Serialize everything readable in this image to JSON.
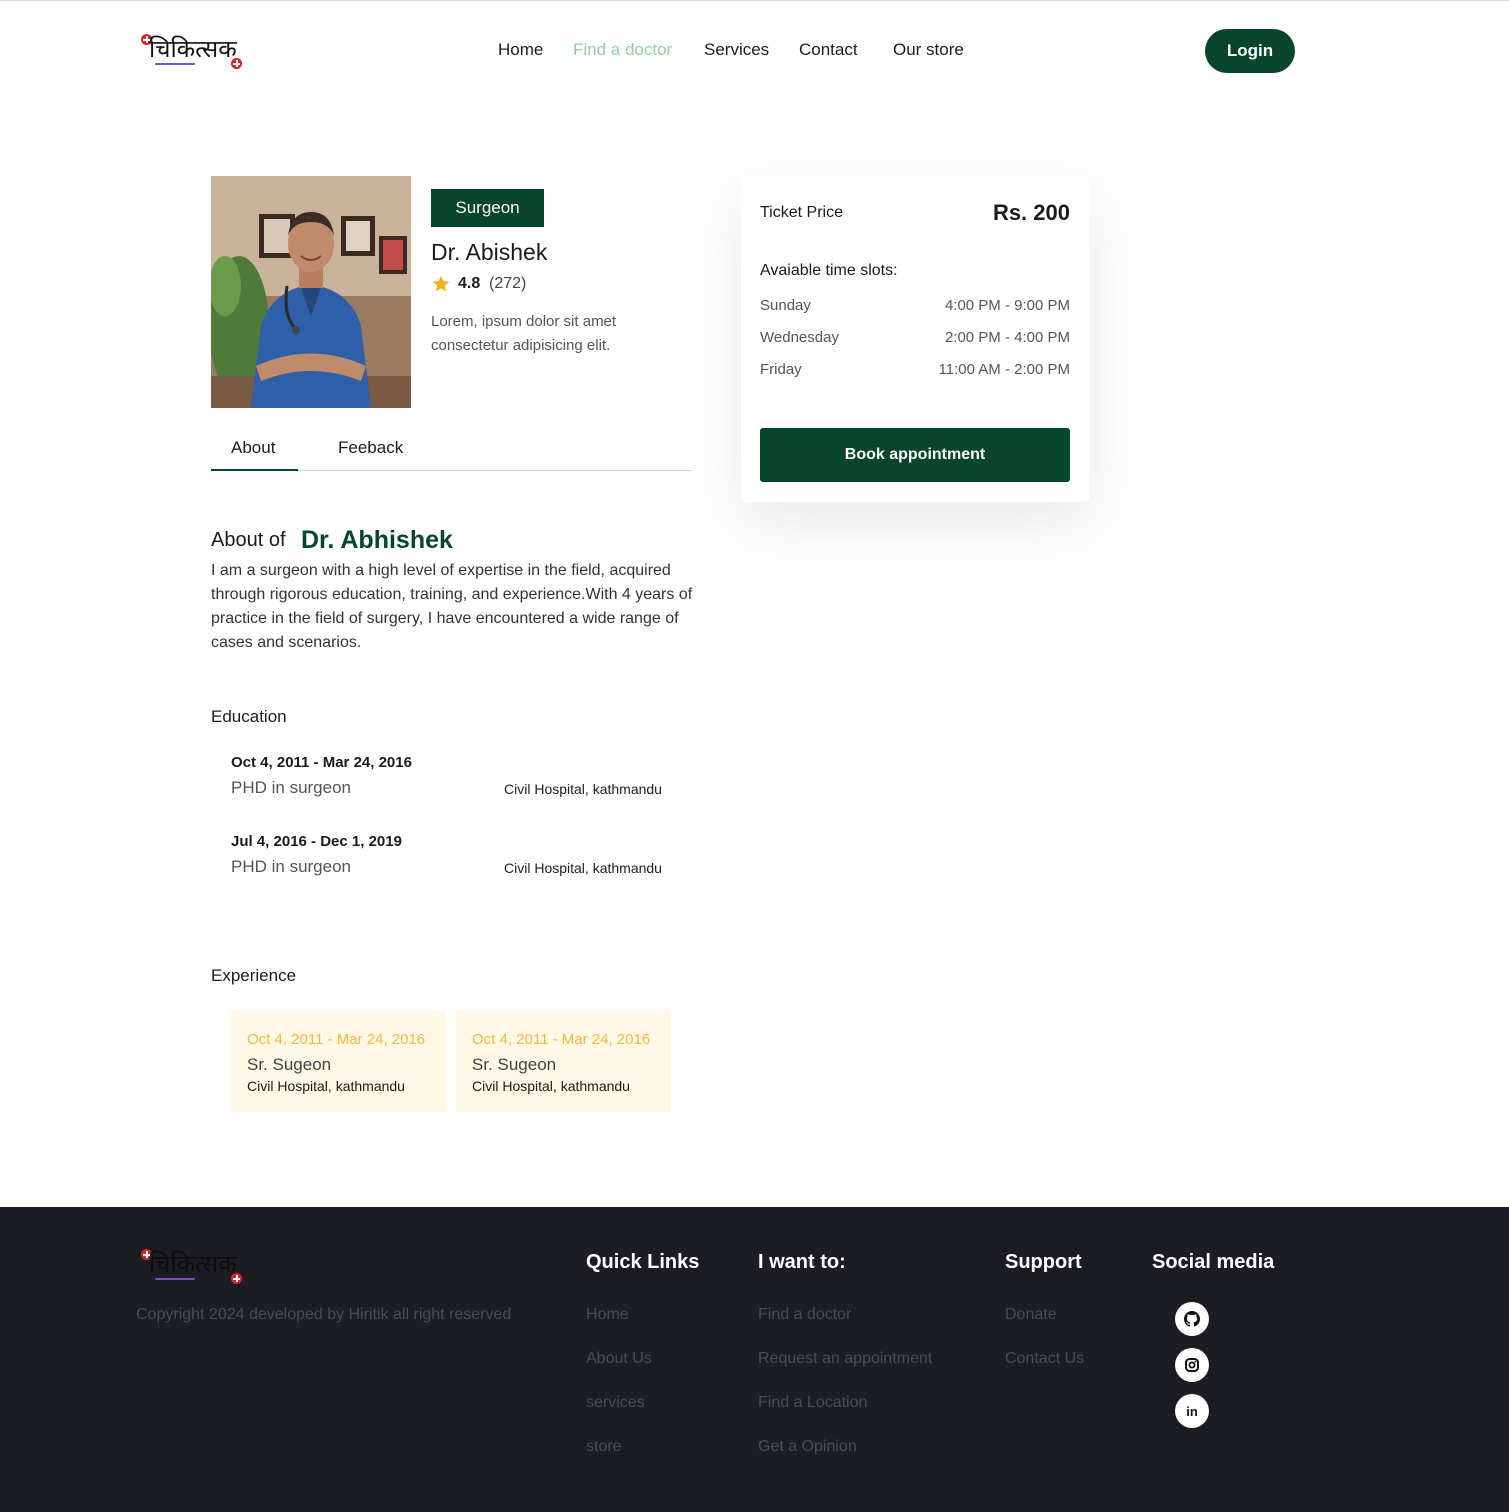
{
  "header": {
    "logo_text": "चिकित्सक",
    "nav": [
      "Home",
      "Find a doctor",
      "Services",
      "Contact",
      "Our store"
    ],
    "login_label": "Login"
  },
  "doctor": {
    "specialty": "Surgeon",
    "name": "Dr. Abishek",
    "rating": "4.8",
    "rating_count": "(272)",
    "short_desc": "Lorem, ipsum dolor sit amet consectetur adipisicing elit."
  },
  "tabs": [
    "About",
    "Feeback"
  ],
  "about": {
    "heading_prefix": "About of",
    "heading_name": "Dr. Abhishek",
    "text": "I am a surgeon with a high level of expertise in the field, acquired through rigorous education, training, and experience.With 4 years of practice in the field of surgery, I have encountered a wide range of cases and scenarios."
  },
  "education": {
    "heading": "Education",
    "items": [
      {
        "date": "Oct 4, 2011 - Mar 24, 2016",
        "degree": "PHD in surgeon",
        "place": "Civil Hospital, kathmandu"
      },
      {
        "date": "Jul 4, 2016 - Dec 1, 2019",
        "degree": "PHD in surgeon",
        "place": "Civil Hospital, kathmandu"
      }
    ]
  },
  "experience": {
    "heading": "Experience",
    "items": [
      {
        "date": "Oct 4, 2011 - Mar 24, 2016",
        "role": "Sr. Sugeon",
        "place": "Civil Hospital, kathmandu"
      },
      {
        "date": "Oct 4, 2011 - Mar 24, 2016",
        "role": "Sr. Sugeon",
        "place": "Civil Hospital, kathmandu"
      }
    ]
  },
  "ticket": {
    "label": "Ticket Price",
    "price": "Rs. 200",
    "slots_heading": "Avaiable time slots:",
    "slots": [
      {
        "day": "Sunday",
        "time": "4:00 PM - 9:00 PM"
      },
      {
        "day": "Wednesday",
        "time": "2:00 PM - 4:00 PM"
      },
      {
        "day": "Friday",
        "time": "11:00 AM - 2:00 PM"
      }
    ],
    "book_label": "Book appointment"
  },
  "footer": {
    "copyright": "Copyright 2024 developed by Hiritik all right reserved",
    "quick_links": {
      "heading": "Quick Links",
      "items": [
        "Home",
        "About Us",
        "services",
        "store"
      ]
    },
    "i_want_to": {
      "heading": "I want to:",
      "items": [
        "Find a doctor",
        "Request an appointment",
        "Find a Location",
        "Get a Opinion"
      ]
    },
    "support": {
      "heading": "Support",
      "items": [
        "Donate",
        "Contact Us"
      ]
    },
    "social": {
      "heading": "Social media",
      "icons": [
        "github-icon",
        "instagram-icon",
        "linkedin-icon"
      ],
      "linkedin_text": "in"
    }
  },
  "colors": {
    "primary": "#08452d",
    "nav_active": "#8fd3a3",
    "star": "#f6b020",
    "experience_bg": "#fff8e6",
    "experience_date": "#f6b73c",
    "footer_bg": "#1c1d22"
  }
}
